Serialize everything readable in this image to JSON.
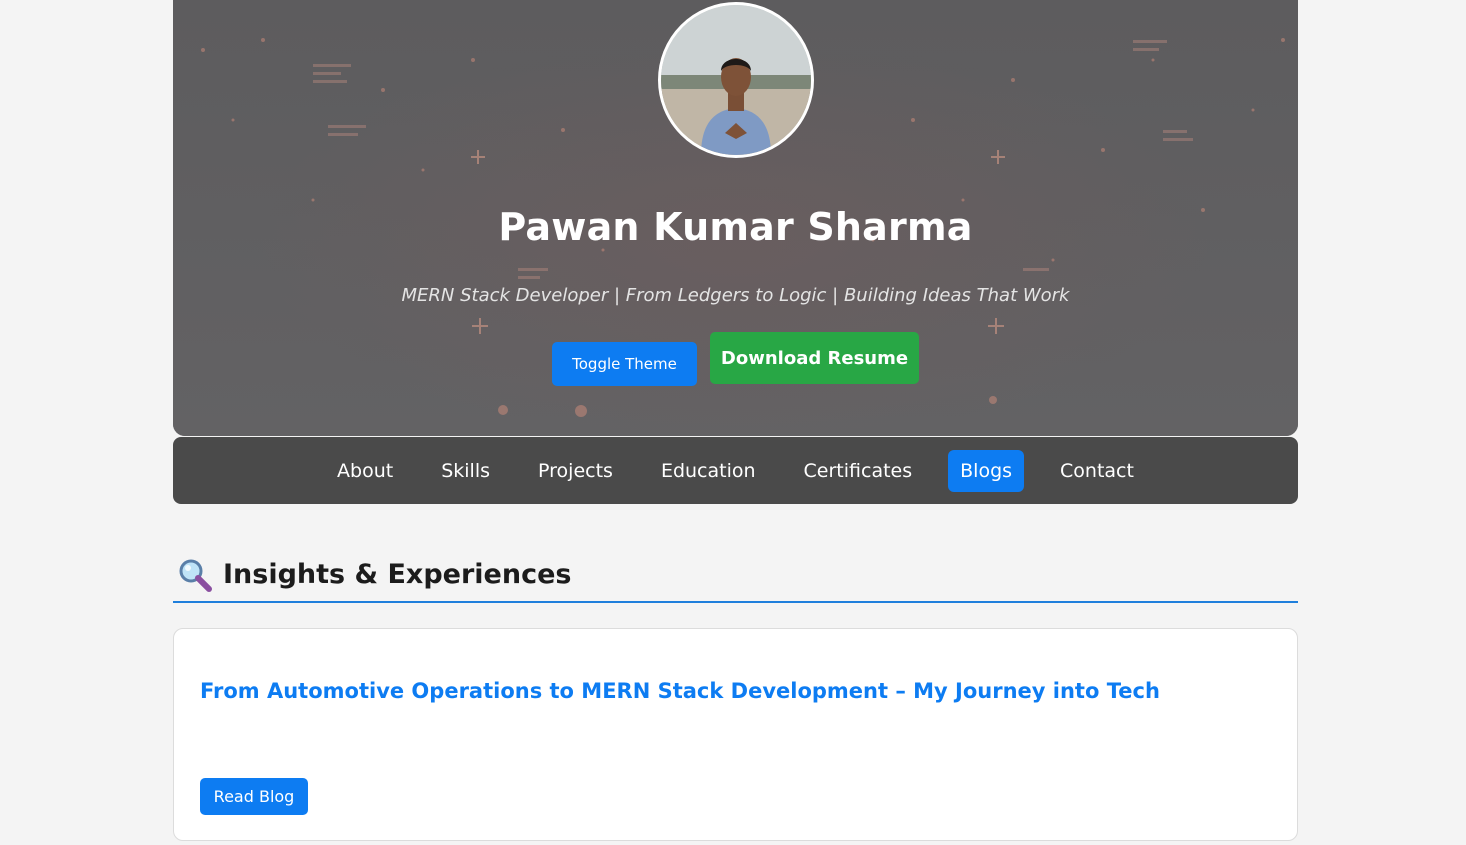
{
  "hero": {
    "name": "Pawan Kumar Sharma",
    "tagline": "MERN Stack Developer | From Ledgers to Logic | Building Ideas That Work",
    "toggle_theme_label": "Toggle Theme",
    "download_resume_label": "Download Resume"
  },
  "nav": {
    "items": [
      {
        "label": "About"
      },
      {
        "label": "Skills"
      },
      {
        "label": "Projects"
      },
      {
        "label": "Education"
      },
      {
        "label": "Certificates"
      },
      {
        "label": "Blogs"
      },
      {
        "label": "Contact"
      }
    ],
    "active": "Blogs"
  },
  "section": {
    "icon": "magnifying-glass-icon",
    "title": "Insights & Experiences"
  },
  "blogs": [
    {
      "title": "From Automotive Operations to MERN Stack Development – My Journey into Tech",
      "button_label": "Read Blog"
    }
  ],
  "colors": {
    "primary": "#0d7cf2",
    "success": "#28a745",
    "nav_bg": "#4a4a4a",
    "hero_bg": "#5f5e60"
  }
}
